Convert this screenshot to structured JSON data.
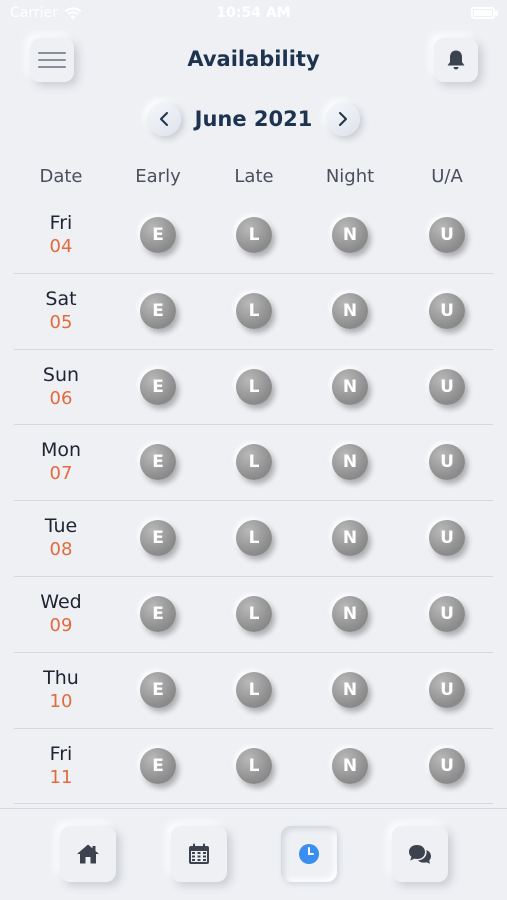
{
  "status_bar": {
    "carrier": "Carrier",
    "time": "10:54 AM"
  },
  "header": {
    "title": "Availability",
    "menu_icon": "hamburger-menu-icon",
    "bell_icon": "bell-icon"
  },
  "month": {
    "label": "June 2021",
    "prev_icon": "chevron-left-icon",
    "next_icon": "chevron-right-icon"
  },
  "columns": {
    "date": "Date",
    "early": "Early",
    "late": "Late",
    "night": "Night",
    "ua": "U/A"
  },
  "shift_letters": {
    "early": "E",
    "late": "L",
    "night": "N",
    "ua": "U"
  },
  "rows": [
    {
      "dow": "Fri",
      "day": "04"
    },
    {
      "dow": "Sat",
      "day": "05"
    },
    {
      "dow": "Sun",
      "day": "06"
    },
    {
      "dow": "Mon",
      "day": "07"
    },
    {
      "dow": "Tue",
      "day": "08"
    },
    {
      "dow": "Wed",
      "day": "09"
    },
    {
      "dow": "Thu",
      "day": "10"
    },
    {
      "dow": "Fri",
      "day": "11"
    }
  ],
  "bottom_nav": [
    {
      "icon": "home-icon"
    },
    {
      "icon": "calendar-icon"
    },
    {
      "icon": "clock-icon",
      "active": true
    },
    {
      "icon": "chat-icon"
    }
  ],
  "colors": {
    "background": "#eef0f4",
    "title": "#1d3350",
    "date_number": "#e26a3d",
    "shift_button": "#9a9a9a",
    "active_icon": "#3a8ef0",
    "nav_icon": "#3d434e"
  }
}
